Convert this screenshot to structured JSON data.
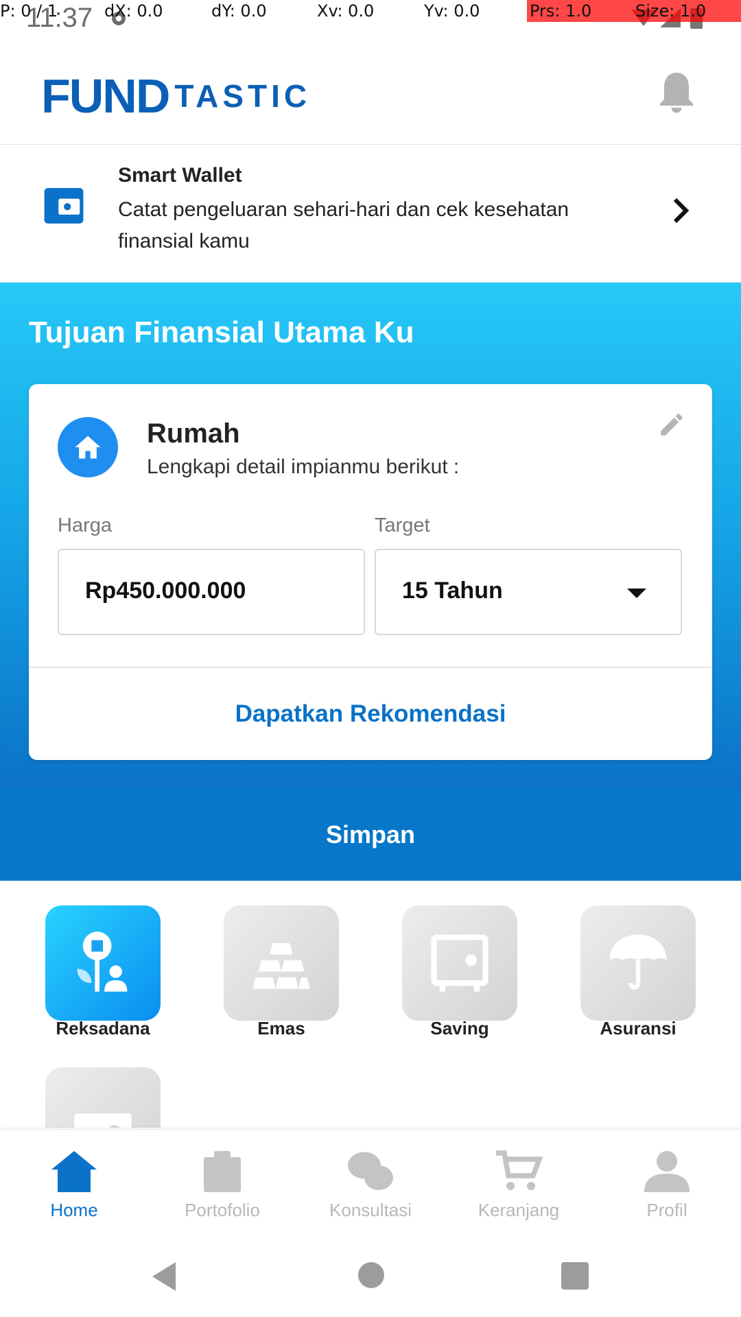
{
  "debug": {
    "p": "P: 0 / 1",
    "dx": "dX: 0.0",
    "dy": "dY: 0.0",
    "xv": "Xv: 0.0",
    "yv": "Yv: 0.0",
    "prs": "Prs: 1.0",
    "size": "Size: 1.0"
  },
  "status": {
    "time": "11:37"
  },
  "header": {
    "brand_fun": "FUND",
    "brand_tastic": "TASTIC",
    "notification_icon": "bell-icon"
  },
  "smart_wallet": {
    "title": "Smart Wallet",
    "description": "Catat pengeluaran sehari-hari dan cek kesehatan finansial kamu",
    "icon": "wallet-icon"
  },
  "goals": {
    "title": "Tujuan Finansial Utama Ku",
    "card": {
      "goal_name": "Rumah",
      "subtitle": "Lengkapi detail impianmu berikut :",
      "price_label": "Harga",
      "price_value": "Rp450.000.000",
      "target_label": "Target",
      "target_value": "15 Tahun",
      "recommend_label": "Dapatkan Rekomendasi"
    }
  },
  "save_button": "Simpan",
  "products": [
    {
      "label": "Reksadana",
      "icon": "mutual-fund-icon",
      "active": true
    },
    {
      "label": "Emas",
      "icon": "gold-bars-icon",
      "active": false
    },
    {
      "label": "Saving",
      "icon": "safe-icon",
      "active": false
    },
    {
      "label": "Asuransi",
      "icon": "umbrella-icon",
      "active": false
    }
  ],
  "bottom_nav": [
    {
      "label": "Home",
      "icon": "home-icon",
      "active": true
    },
    {
      "label": "Portofolio",
      "icon": "clipboard-icon",
      "active": false
    },
    {
      "label": "Konsultasi",
      "icon": "chat-icon",
      "active": false
    },
    {
      "label": "Keranjang",
      "icon": "cart-icon",
      "active": false
    },
    {
      "label": "Profil",
      "icon": "person-icon",
      "active": false
    }
  ],
  "colors": {
    "primary": "#0a72c8",
    "gradient_top": "#27c8f7",
    "gradient_bottom": "#0b72c7",
    "inactive": "#b8b8b8"
  }
}
